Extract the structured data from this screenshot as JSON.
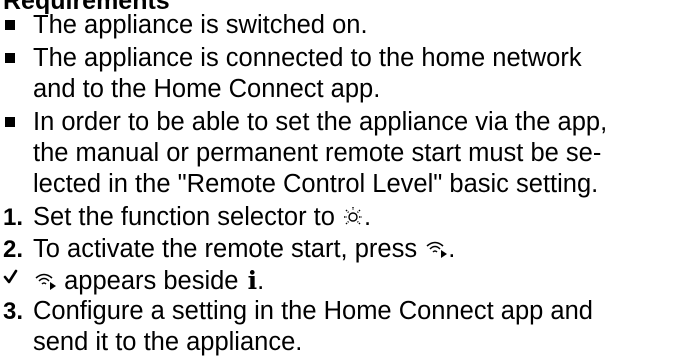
{
  "heading": "Requirements",
  "requirements": [
    "The appliance is switched on.",
    "The appliance is connected to the home network",
    "and to the Home Connect app.",
    "In order to be able to set the appliance via the app,",
    "the manual or permanent remote start must be se-",
    "lected in the \"Remote Control Level\" basic setting."
  ],
  "steps": {
    "step1_num": "1.",
    "step1_text": "Set the function selector to",
    "step1_end": ".",
    "step2_num": "2.",
    "step2_text": "To activate the remote start, press",
    "step2_end": ".",
    "result_mid": "appears beside",
    "result_end": ".",
    "info_letter": "i",
    "step3_num": "3.",
    "step3_line1": "Configure a setting in the Home Connect app and",
    "step3_line2": "send it to the appliance."
  },
  "icons": {
    "function_selector": "light-icon",
    "remote_start": "remote-start-icon",
    "result": "check-icon"
  }
}
